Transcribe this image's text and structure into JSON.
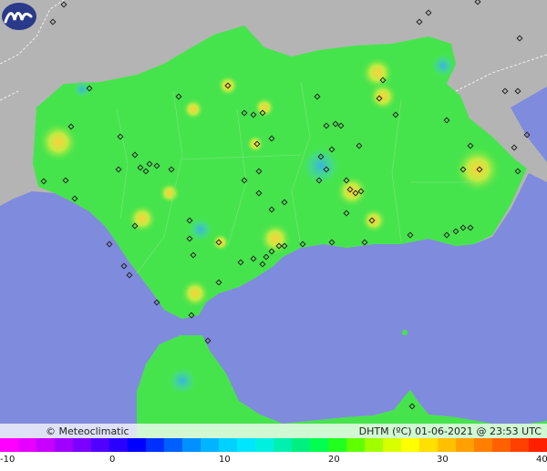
{
  "credit": "© Meteoclimatic",
  "stamp": "DHTM (ºC)  01-06-2021 @ 23:53 UTC",
  "scale": {
    "ticks": [
      "-10",
      "0",
      "10",
      "20",
      "30",
      "40"
    ],
    "colors": [
      "#ff00ff",
      "#e600ff",
      "#c800ff",
      "#a000ff",
      "#7a00ff",
      "#5000ff",
      "#2a00ff",
      "#0000ff",
      "#0030ff",
      "#0060ff",
      "#0090ff",
      "#00b4ff",
      "#00d2ff",
      "#00e6ff",
      "#00f0e0",
      "#00f0b0",
      "#00f080",
      "#00ff50",
      "#20ff20",
      "#60ff00",
      "#a0ff00",
      "#d8ff00",
      "#ffff00",
      "#ffe000",
      "#ffc000",
      "#ffa000",
      "#ff8000",
      "#ff6000",
      "#ff4000",
      "#ff2000"
    ]
  },
  "colors": {
    "sea": "#7f8bdc",
    "land": "#b4b4b4",
    "region": "#46e44c",
    "warm": "#e8e23a",
    "cool": "#4fc2d8"
  }
}
